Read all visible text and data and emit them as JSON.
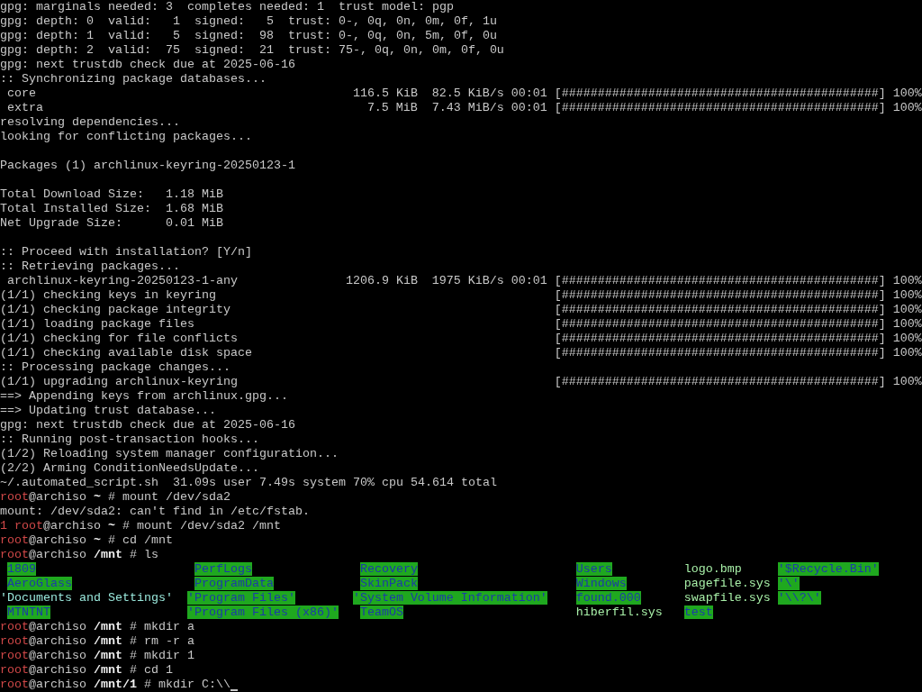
{
  "terminal": {
    "lines": [
      {
        "kind": "text",
        "text": "gpg: marginals needed: 3  completes needed: 1  trust model: pgp"
      },
      {
        "kind": "text",
        "text": "gpg: depth: 0  valid:   1  signed:   5  trust: 0-, 0q, 0n, 0m, 0f, 1u"
      },
      {
        "kind": "text",
        "text": "gpg: depth: 1  valid:   5  signed:  98  trust: 0-, 0q, 0n, 5m, 0f, 0u"
      },
      {
        "kind": "text",
        "text": "gpg: depth: 2  valid:  75  signed:  21  trust: 75-, 0q, 0n, 0m, 0f, 0u"
      },
      {
        "kind": "text",
        "text": "gpg: next trustdb check due at 2025-06-16"
      },
      {
        "kind": "text",
        "text": ":: Synchronizing package databases..."
      },
      {
        "kind": "progress",
        "name": " core",
        "size": "116.5 KiB",
        "rate": "82.5 KiB/s",
        "time": "00:01",
        "bar": "[############################################]",
        "percent": "100%"
      },
      {
        "kind": "progress",
        "name": " extra",
        "size": "7.5 MiB",
        "rate": "7.43 MiB/s",
        "time": "00:01",
        "bar": "[############################################]",
        "percent": "100%"
      },
      {
        "kind": "text",
        "text": "resolving dependencies..."
      },
      {
        "kind": "text",
        "text": "looking for conflicting packages..."
      },
      {
        "kind": "blank"
      },
      {
        "kind": "text",
        "text": "Packages (1) archlinux-keyring-20250123-1"
      },
      {
        "kind": "blank"
      },
      {
        "kind": "text",
        "text": "Total Download Size:   1.18 MiB"
      },
      {
        "kind": "text",
        "text": "Total Installed Size:  1.68 MiB"
      },
      {
        "kind": "text",
        "text": "Net Upgrade Size:      0.01 MiB"
      },
      {
        "kind": "blank"
      },
      {
        "kind": "text",
        "text": ":: Proceed with installation? [Y/n]"
      },
      {
        "kind": "text",
        "text": ":: Retrieving packages..."
      },
      {
        "kind": "progress",
        "name": " archlinux-keyring-20250123-1-any",
        "size": "1206.9 KiB",
        "rate": "1975 KiB/s",
        "time": "00:01",
        "bar": "[############################################]",
        "percent": "100%"
      },
      {
        "kind": "progress",
        "name": "(1/1) checking keys in keyring",
        "bar": "[############################################]",
        "percent": "100%"
      },
      {
        "kind": "progress",
        "name": "(1/1) checking package integrity",
        "bar": "[############################################]",
        "percent": "100%"
      },
      {
        "kind": "progress",
        "name": "(1/1) loading package files",
        "bar": "[############################################]",
        "percent": "100%"
      },
      {
        "kind": "progress",
        "name": "(1/1) checking for file conflicts",
        "bar": "[############################################]",
        "percent": "100%"
      },
      {
        "kind": "progress",
        "name": "(1/1) checking available disk space",
        "bar": "[############################################]",
        "percent": "100%"
      },
      {
        "kind": "text",
        "text": ":: Processing package changes..."
      },
      {
        "kind": "progress",
        "name": "(1/1) upgrading archlinux-keyring",
        "bar": "[############################################]",
        "percent": "100%"
      },
      {
        "kind": "text",
        "text": "==> Appending keys from archlinux.gpg..."
      },
      {
        "kind": "text",
        "text": "==> Updating trust database..."
      },
      {
        "kind": "text",
        "text": "gpg: next trustdb check due at 2025-06-16"
      },
      {
        "kind": "text",
        "text": ":: Running post-transaction hooks..."
      },
      {
        "kind": "text",
        "text": "(1/2) Reloading system manager configuration..."
      },
      {
        "kind": "text",
        "text": "(2/2) Arming ConditionNeedsUpdate..."
      },
      {
        "kind": "text",
        "text": "~/.automated_script.sh  31.09s user 7.49s system 70% cpu 54.614 total"
      },
      {
        "kind": "prompt",
        "user": "root",
        "host": "@archiso",
        "cwd": "~",
        "symbol": "#",
        "command": "mount /dev/sda2"
      },
      {
        "kind": "text",
        "text": "mount: /dev/sda2: can't find in /etc/fstab."
      },
      {
        "kind": "prompt",
        "exit_code": "1",
        "user": "root",
        "host": "@archiso",
        "cwd": "~",
        "symbol": "#",
        "command": "mount /dev/sda2 /mnt"
      },
      {
        "kind": "prompt",
        "user": "root",
        "host": "@archiso",
        "cwd": "~",
        "symbol": "#",
        "command": "cd /mnt"
      },
      {
        "kind": "prompt",
        "user": "root",
        "host": "@archiso",
        "cwd": "/mnt",
        "symbol": "#",
        "command": "ls"
      },
      {
        "kind": "ls",
        "entries": [
          {
            "name": " 1809",
            "kind": "dir"
          },
          {
            "name": " PerfLogs",
            "kind": "dir"
          },
          {
            "name": " Recovery",
            "kind": "dir"
          },
          {
            "name": " Users",
            "kind": "dir"
          },
          {
            "name": " logo.bmp",
            "kind": "file"
          },
          {
            "name": "'$Recycle.Bin'",
            "kind": "dir"
          }
        ]
      },
      {
        "kind": "ls",
        "entries": [
          {
            "name": " AeroGlass",
            "kind": "dir"
          },
          {
            "name": " ProgramData",
            "kind": "dir"
          },
          {
            "name": " SkinPack",
            "kind": "dir"
          },
          {
            "name": " Windows",
            "kind": "dir"
          },
          {
            "name": " pagefile.sys",
            "kind": "file"
          },
          {
            "name": "'\\'",
            "kind": "dir"
          }
        ]
      },
      {
        "kind": "ls",
        "entries": [
          {
            "name": "'Documents and Settings'",
            "kind": "link"
          },
          {
            "name": "'Program Files'",
            "kind": "dir"
          },
          {
            "name": "'System Volume Information'",
            "kind": "dir"
          },
          {
            "name": " found.000",
            "kind": "dir"
          },
          {
            "name": " swapfile.sys",
            "kind": "file"
          },
          {
            "name": "'\\\\?\\'",
            "kind": "dir"
          }
        ]
      },
      {
        "kind": "ls",
        "entries": [
          {
            "name": " MTNTNT",
            "kind": "dir"
          },
          {
            "name": "'Program Files (x86)'",
            "kind": "dir"
          },
          {
            "name": " TeamOS",
            "kind": "dir"
          },
          {
            "name": " hiberfil.sys",
            "kind": "file"
          },
          {
            "name": " test",
            "kind": "dir"
          }
        ]
      },
      {
        "kind": "prompt",
        "user": "root",
        "host": "@archiso",
        "cwd": "/mnt",
        "symbol": "#",
        "command": "mkdir a"
      },
      {
        "kind": "prompt",
        "user": "root",
        "host": "@archiso",
        "cwd": "/mnt",
        "symbol": "#",
        "command": "rm -r a"
      },
      {
        "kind": "prompt",
        "user": "root",
        "host": "@archiso",
        "cwd": "/mnt",
        "symbol": "#",
        "command": "mkdir 1"
      },
      {
        "kind": "prompt",
        "user": "root",
        "host": "@archiso",
        "cwd": "/mnt",
        "symbol": "#",
        "command": "cd 1"
      },
      {
        "kind": "prompt",
        "user": "root",
        "host": "@archiso",
        "cwd": "/mnt/1",
        "symbol": "#",
        "command": "mkdir C:\\\\",
        "cursor": true
      }
    ]
  }
}
